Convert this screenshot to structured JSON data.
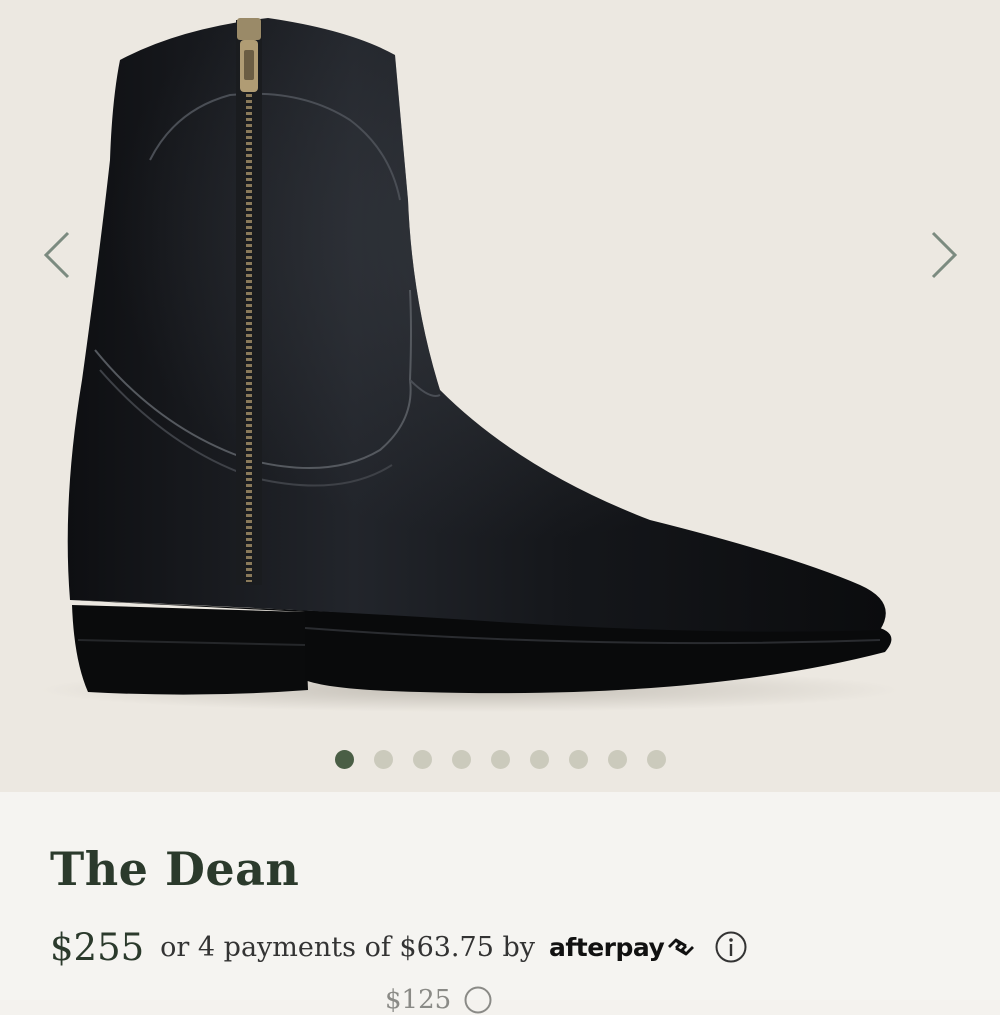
{
  "product": {
    "name": "The Dean",
    "price": "$255",
    "installment_text": "or 4 payments of $63.75 by",
    "afterpay_label": "afterpay",
    "secondary_price_partial": "$125"
  },
  "gallery": {
    "image_alt": "Black leather zip-up western ankle boot",
    "slide_count": 9,
    "active_slide": 1,
    "prev_icon": "chevron-left-icon",
    "next_icon": "chevron-right-icon"
  },
  "colors": {
    "brand_green": "#2b3a2c",
    "dot_active": "#4a5e45",
    "dot_inactive": "#cbcabc",
    "gallery_bg": "#ece8e1"
  }
}
